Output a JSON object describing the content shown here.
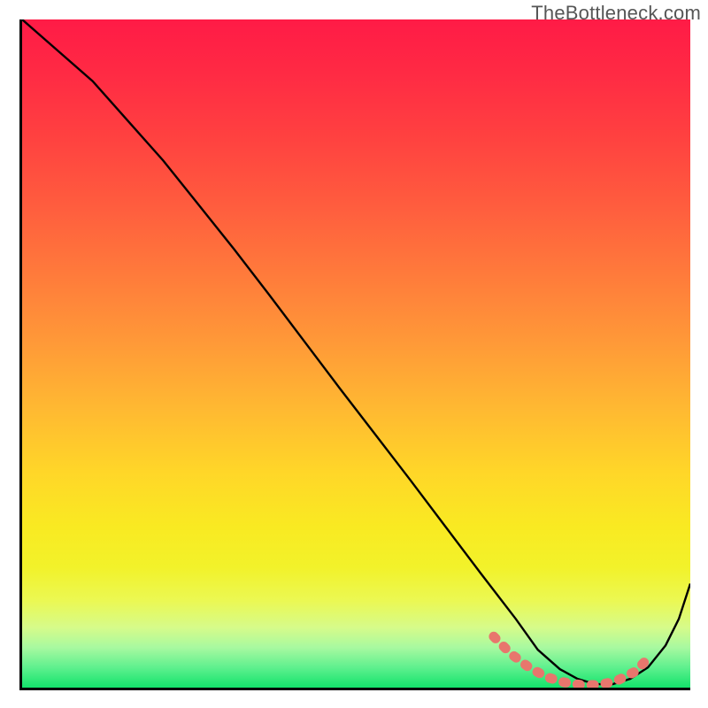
{
  "watermark": "TheBottleneck.com",
  "chart_data": {
    "type": "line",
    "title": "",
    "xlabel": "",
    "ylabel": "",
    "xlim": [
      0,
      100
    ],
    "ylim": [
      0,
      100
    ],
    "series": [
      {
        "name": "curve",
        "x": [
          0,
          5,
          10,
          15,
          20,
          25,
          30,
          35,
          40,
          45,
          50,
          55,
          60,
          65,
          70,
          73,
          76,
          79,
          82,
          85,
          88,
          91,
          94,
          97,
          100
        ],
        "values": [
          100,
          96,
          92,
          86,
          80,
          73,
          66,
          59,
          52,
          45,
          38,
          31,
          24,
          17,
          10,
          6,
          3,
          1,
          0,
          0,
          1,
          3,
          7,
          14,
          24
        ]
      },
      {
        "name": "markers",
        "x": [
          70,
          72,
          74,
          76,
          78,
          80,
          82,
          84,
          86,
          88,
          90
        ],
        "values": [
          7,
          5,
          3,
          2,
          1,
          0,
          0,
          0,
          1,
          2,
          4
        ]
      }
    ],
    "gradient_bands": [
      {
        "pos": 0,
        "color": "#ff1b46"
      },
      {
        "pos": 18,
        "color": "#ff4240"
      },
      {
        "pos": 38,
        "color": "#ff7a3b"
      },
      {
        "pos": 58,
        "color": "#ffb832"
      },
      {
        "pos": 76,
        "color": "#f9ea22"
      },
      {
        "pos": 91,
        "color": "#d6fb8a"
      },
      {
        "pos": 100,
        "color": "#13e36b"
      }
    ]
  }
}
